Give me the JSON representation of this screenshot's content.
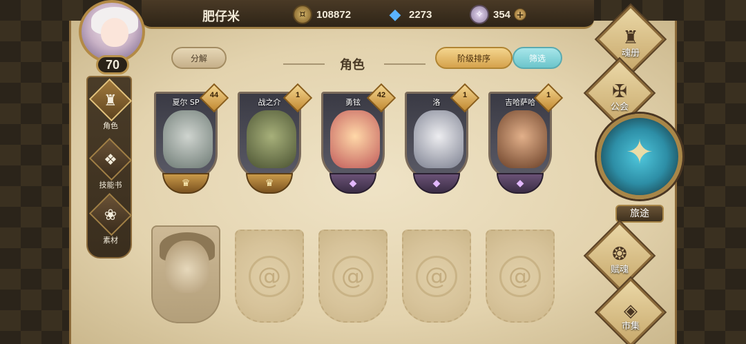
{
  "player": {
    "name": "肥仔米",
    "level": "70"
  },
  "resources": {
    "coins": "108872",
    "crystals": "2273",
    "gems": "354",
    "add_symbol": "+"
  },
  "left_nav": [
    {
      "label": "角色",
      "icon": "helmet-icon",
      "glyph": "♜",
      "active": true
    },
    {
      "label": "技能书",
      "icon": "book-icon",
      "glyph": "❖",
      "active": false
    },
    {
      "label": "素材",
      "icon": "materials-icon",
      "glyph": "❀",
      "active": false
    }
  ],
  "panel": {
    "title": "角色",
    "decompose_label": "分解",
    "sort_label": "阶级排序",
    "filter_label": "筛选"
  },
  "characters": [
    {
      "name": "夏尔 SP",
      "level": "44",
      "rarity": "gold",
      "colors": [
        "#cfd4cf",
        "#6d7a74"
      ]
    },
    {
      "name": "战之介",
      "level": "1",
      "rarity": "gold",
      "colors": [
        "#a7b07a",
        "#4a5232"
      ]
    },
    {
      "name": "勇铉",
      "level": "42",
      "rarity": "purple",
      "colors": [
        "#ffd8a8",
        "#c05a5a"
      ]
    },
    {
      "name": "洛",
      "level": "1",
      "rarity": "purple",
      "colors": [
        "#ededf0",
        "#7c8090"
      ]
    },
    {
      "name": "吉哈萨哈",
      "level": "1",
      "rarity": "purple",
      "colors": [
        "#e2b08a",
        "#6a4028"
      ]
    }
  ],
  "emblem_glyphs": {
    "gold": "♛",
    "purple": "◆"
  },
  "empty_slot_glyph": "@",
  "right_nav": [
    {
      "label": "魂册",
      "icon": "soul-book-icon",
      "glyph": "♜"
    },
    {
      "label": "公会",
      "icon": "guild-icon",
      "glyph": "✠"
    },
    {
      "label": "赋魂",
      "icon": "soul-imbue-icon",
      "glyph": "❂"
    },
    {
      "label": "市集",
      "icon": "market-icon",
      "glyph": "◈"
    }
  ],
  "journey": {
    "label": "旅途",
    "glyph": "✦"
  },
  "icons": {
    "coin": "¤",
    "crystal": "◆",
    "gem": "✧"
  }
}
